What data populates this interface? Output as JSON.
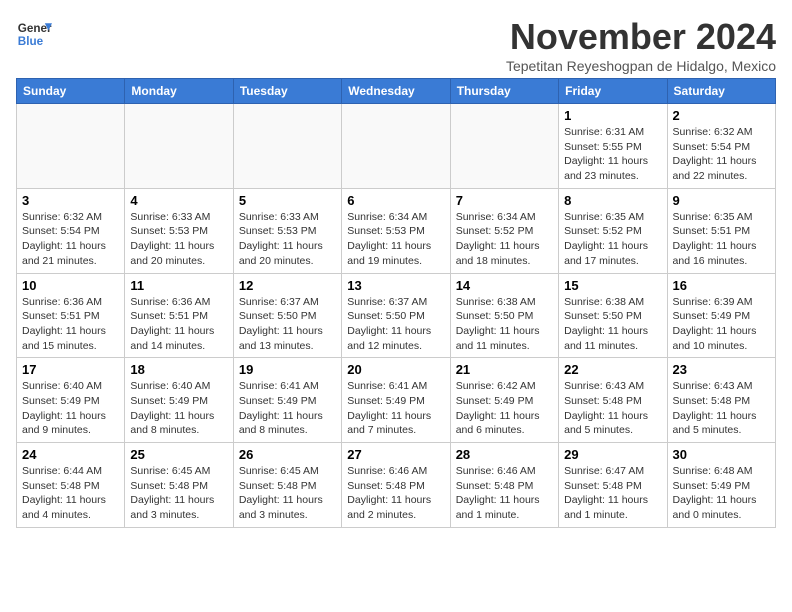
{
  "header": {
    "logo_line1": "General",
    "logo_line2": "Blue",
    "month_title": "November 2024",
    "subtitle": "Tepetitan Reyeshogpan de Hidalgo, Mexico"
  },
  "days_of_week": [
    "Sunday",
    "Monday",
    "Tuesday",
    "Wednesday",
    "Thursday",
    "Friday",
    "Saturday"
  ],
  "weeks": [
    {
      "days": [
        {
          "date": "",
          "info": ""
        },
        {
          "date": "",
          "info": ""
        },
        {
          "date": "",
          "info": ""
        },
        {
          "date": "",
          "info": ""
        },
        {
          "date": "",
          "info": ""
        },
        {
          "date": "1",
          "info": "Sunrise: 6:31 AM\nSunset: 5:55 PM\nDaylight: 11 hours and 23 minutes."
        },
        {
          "date": "2",
          "info": "Sunrise: 6:32 AM\nSunset: 5:54 PM\nDaylight: 11 hours and 22 minutes."
        }
      ]
    },
    {
      "days": [
        {
          "date": "3",
          "info": "Sunrise: 6:32 AM\nSunset: 5:54 PM\nDaylight: 11 hours and 21 minutes."
        },
        {
          "date": "4",
          "info": "Sunrise: 6:33 AM\nSunset: 5:53 PM\nDaylight: 11 hours and 20 minutes."
        },
        {
          "date": "5",
          "info": "Sunrise: 6:33 AM\nSunset: 5:53 PM\nDaylight: 11 hours and 20 minutes."
        },
        {
          "date": "6",
          "info": "Sunrise: 6:34 AM\nSunset: 5:53 PM\nDaylight: 11 hours and 19 minutes."
        },
        {
          "date": "7",
          "info": "Sunrise: 6:34 AM\nSunset: 5:52 PM\nDaylight: 11 hours and 18 minutes."
        },
        {
          "date": "8",
          "info": "Sunrise: 6:35 AM\nSunset: 5:52 PM\nDaylight: 11 hours and 17 minutes."
        },
        {
          "date": "9",
          "info": "Sunrise: 6:35 AM\nSunset: 5:51 PM\nDaylight: 11 hours and 16 minutes."
        }
      ]
    },
    {
      "days": [
        {
          "date": "10",
          "info": "Sunrise: 6:36 AM\nSunset: 5:51 PM\nDaylight: 11 hours and 15 minutes."
        },
        {
          "date": "11",
          "info": "Sunrise: 6:36 AM\nSunset: 5:51 PM\nDaylight: 11 hours and 14 minutes."
        },
        {
          "date": "12",
          "info": "Sunrise: 6:37 AM\nSunset: 5:50 PM\nDaylight: 11 hours and 13 minutes."
        },
        {
          "date": "13",
          "info": "Sunrise: 6:37 AM\nSunset: 5:50 PM\nDaylight: 11 hours and 12 minutes."
        },
        {
          "date": "14",
          "info": "Sunrise: 6:38 AM\nSunset: 5:50 PM\nDaylight: 11 hours and 11 minutes."
        },
        {
          "date": "15",
          "info": "Sunrise: 6:38 AM\nSunset: 5:50 PM\nDaylight: 11 hours and 11 minutes."
        },
        {
          "date": "16",
          "info": "Sunrise: 6:39 AM\nSunset: 5:49 PM\nDaylight: 11 hours and 10 minutes."
        }
      ]
    },
    {
      "days": [
        {
          "date": "17",
          "info": "Sunrise: 6:40 AM\nSunset: 5:49 PM\nDaylight: 11 hours and 9 minutes."
        },
        {
          "date": "18",
          "info": "Sunrise: 6:40 AM\nSunset: 5:49 PM\nDaylight: 11 hours and 8 minutes."
        },
        {
          "date": "19",
          "info": "Sunrise: 6:41 AM\nSunset: 5:49 PM\nDaylight: 11 hours and 8 minutes."
        },
        {
          "date": "20",
          "info": "Sunrise: 6:41 AM\nSunset: 5:49 PM\nDaylight: 11 hours and 7 minutes."
        },
        {
          "date": "21",
          "info": "Sunrise: 6:42 AM\nSunset: 5:49 PM\nDaylight: 11 hours and 6 minutes."
        },
        {
          "date": "22",
          "info": "Sunrise: 6:43 AM\nSunset: 5:48 PM\nDaylight: 11 hours and 5 minutes."
        },
        {
          "date": "23",
          "info": "Sunrise: 6:43 AM\nSunset: 5:48 PM\nDaylight: 11 hours and 5 minutes."
        }
      ]
    },
    {
      "days": [
        {
          "date": "24",
          "info": "Sunrise: 6:44 AM\nSunset: 5:48 PM\nDaylight: 11 hours and 4 minutes."
        },
        {
          "date": "25",
          "info": "Sunrise: 6:45 AM\nSunset: 5:48 PM\nDaylight: 11 hours and 3 minutes."
        },
        {
          "date": "26",
          "info": "Sunrise: 6:45 AM\nSunset: 5:48 PM\nDaylight: 11 hours and 3 minutes."
        },
        {
          "date": "27",
          "info": "Sunrise: 6:46 AM\nSunset: 5:48 PM\nDaylight: 11 hours and 2 minutes."
        },
        {
          "date": "28",
          "info": "Sunrise: 6:46 AM\nSunset: 5:48 PM\nDaylight: 11 hours and 1 minute."
        },
        {
          "date": "29",
          "info": "Sunrise: 6:47 AM\nSunset: 5:48 PM\nDaylight: 11 hours and 1 minute."
        },
        {
          "date": "30",
          "info": "Sunrise: 6:48 AM\nSunset: 5:49 PM\nDaylight: 11 hours and 0 minutes."
        }
      ]
    }
  ]
}
